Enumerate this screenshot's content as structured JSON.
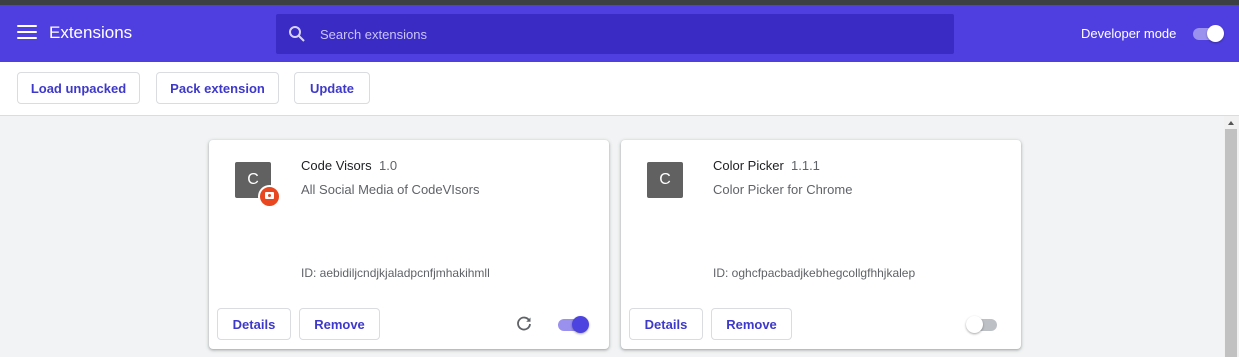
{
  "header": {
    "title": "Extensions",
    "search_placeholder": "Search extensions",
    "developer_mode_label": "Developer mode",
    "developer_mode_on": true
  },
  "toolbar": {
    "load_unpacked": "Load unpacked",
    "pack_extension": "Pack extension",
    "update": "Update"
  },
  "extensions": [
    {
      "icon_letter": "C",
      "name": "Code Visors",
      "version": "1.0",
      "description": "All Social Media of CodeVIsors",
      "id_text": "ID: aebidiljcndjkjaladpcnfjmhakihmll",
      "details_label": "Details",
      "remove_label": "Remove",
      "enabled": true,
      "has_badge": true
    },
    {
      "icon_letter": "C",
      "name": "Color Picker",
      "version": "1.1.1",
      "description": "Color Picker for Chrome",
      "id_text": "ID: oghcfpacbadjkebhegcollgfhhjkalep",
      "details_label": "Details",
      "remove_label": "Remove",
      "enabled": false,
      "has_badge": false
    }
  ],
  "colors": {
    "header_bg": "#4f3fe0",
    "search_bg": "#3a2bc4",
    "accent_text": "#3e39c9",
    "toggle_on": "#4c43e0"
  },
  "icons": [
    "menu-icon",
    "search-icon",
    "reload-icon",
    "extension-badge-icon"
  ]
}
